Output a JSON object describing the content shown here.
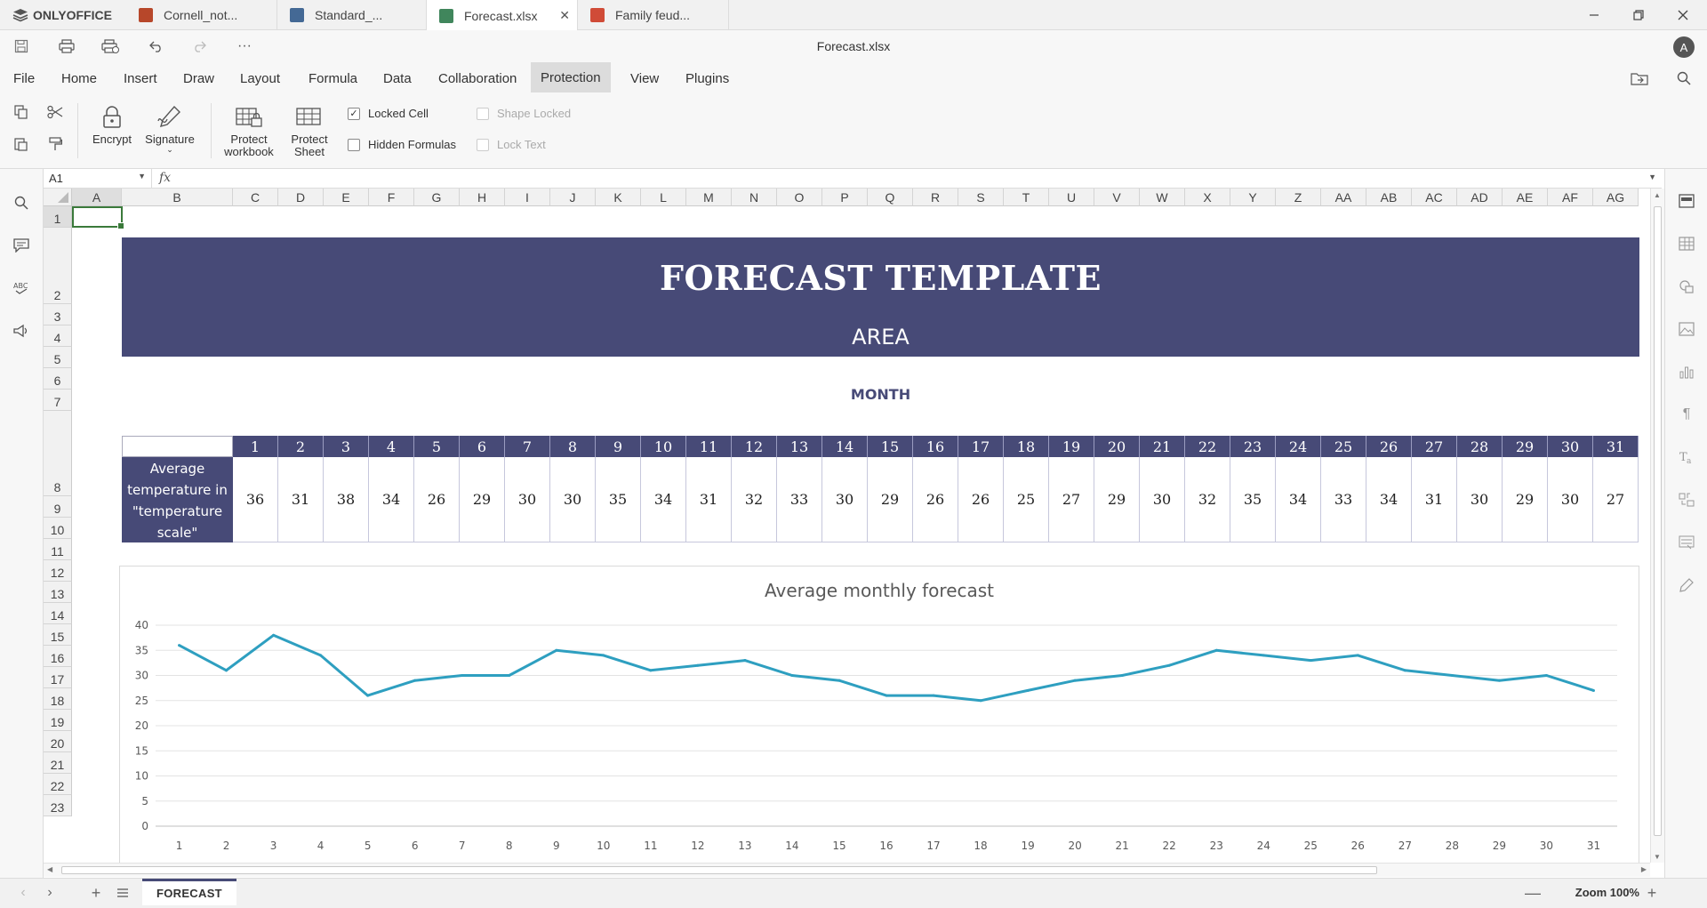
{
  "app": {
    "brand": "ONLYOFFICE",
    "tabs": [
      {
        "label": "Cornell_not...",
        "type": "presentation",
        "color": "#b7472a"
      },
      {
        "label": "Standard_...",
        "type": "document",
        "color": "#446995"
      },
      {
        "label": "Forecast.xlsx",
        "type": "spreadsheet",
        "color": "#40865c",
        "active": true
      },
      {
        "label": "Family feud...",
        "type": "presentation",
        "color": "#d04b37"
      }
    ],
    "doc_title": "Forecast.xlsx",
    "user_initial": "A"
  },
  "menu": {
    "items": [
      "File",
      "Home",
      "Insert",
      "Draw",
      "Layout",
      "Formula",
      "Data",
      "Collaboration",
      "Protection",
      "View",
      "Plugins"
    ],
    "active": "Protection"
  },
  "ribbon": {
    "encrypt": "Encrypt",
    "signature": "Signature",
    "protect_workbook_1": "Protect",
    "protect_workbook_2": "workbook",
    "protect_sheet_1": "Protect",
    "protect_sheet_2": "Sheet",
    "locked_cell": "Locked Cell",
    "hidden_formulas": "Hidden Formulas",
    "shape_locked": "Shape Locked",
    "lock_text": "Lock Text"
  },
  "formula_bar": {
    "cell_ref": "A1",
    "fx": "fx",
    "value": ""
  },
  "columns": [
    "A",
    "B",
    "C",
    "D",
    "E",
    "F",
    "G",
    "H",
    "I",
    "J",
    "K",
    "L",
    "M",
    "N",
    "O",
    "P",
    "Q",
    "R",
    "S",
    "T",
    "U",
    "V",
    "W",
    "X",
    "Y",
    "Z",
    "AA",
    "AB",
    "AC",
    "AD",
    "AE",
    "AF",
    "AG"
  ],
  "rows": [
    "1",
    "2",
    "3",
    "4",
    "5",
    "6",
    "7",
    "8",
    "9",
    "10",
    "11",
    "12",
    "13",
    "14",
    "15",
    "16",
    "17",
    "18",
    "19",
    "20",
    "21",
    "22",
    "23"
  ],
  "sheet": {
    "title": "FORECAST TEMPLATE",
    "subtitle": "AREA",
    "month_label": "MONTH",
    "row_label_1": "Average",
    "row_label_2": "temperature in",
    "row_label_3": "\"temperature",
    "row_label_4": "scale\"",
    "days": [
      "1",
      "2",
      "3",
      "4",
      "5",
      "6",
      "7",
      "8",
      "9",
      "10",
      "11",
      "12",
      "13",
      "14",
      "15",
      "16",
      "17",
      "18",
      "19",
      "20",
      "21",
      "22",
      "23",
      "24",
      "25",
      "26",
      "27",
      "28",
      "29",
      "30",
      "31"
    ],
    "temps": [
      "36",
      "31",
      "38",
      "34",
      "26",
      "29",
      "30",
      "30",
      "35",
      "34",
      "31",
      "32",
      "33",
      "30",
      "29",
      "26",
      "26",
      "25",
      "27",
      "29",
      "30",
      "32",
      "35",
      "34",
      "33",
      "34",
      "31",
      "30",
      "29",
      "30",
      "27"
    ]
  },
  "chart_data": {
    "type": "line",
    "title": "Average monthly forecast",
    "x": [
      1,
      2,
      3,
      4,
      5,
      6,
      7,
      8,
      9,
      10,
      11,
      12,
      13,
      14,
      15,
      16,
      17,
      18,
      19,
      20,
      21,
      22,
      23,
      24,
      25,
      26,
      27,
      28,
      29,
      30,
      31
    ],
    "series": [
      {
        "values": [
          36,
          31,
          38,
          34,
          26,
          29,
          30,
          30,
          35,
          34,
          31,
          32,
          33,
          30,
          29,
          26,
          26,
          25,
          27,
          29,
          30,
          32,
          35,
          34,
          33,
          34,
          31,
          30,
          29,
          30,
          27
        ],
        "color": "#2e9fc0"
      }
    ],
    "ylim": [
      0,
      40
    ],
    "yticks": [
      0,
      5,
      10,
      15,
      20,
      25,
      30,
      35,
      40
    ],
    "grid": true,
    "legend": "none"
  },
  "status": {
    "sheet_tab": "FORECAST",
    "zoom": "Zoom 100%"
  }
}
